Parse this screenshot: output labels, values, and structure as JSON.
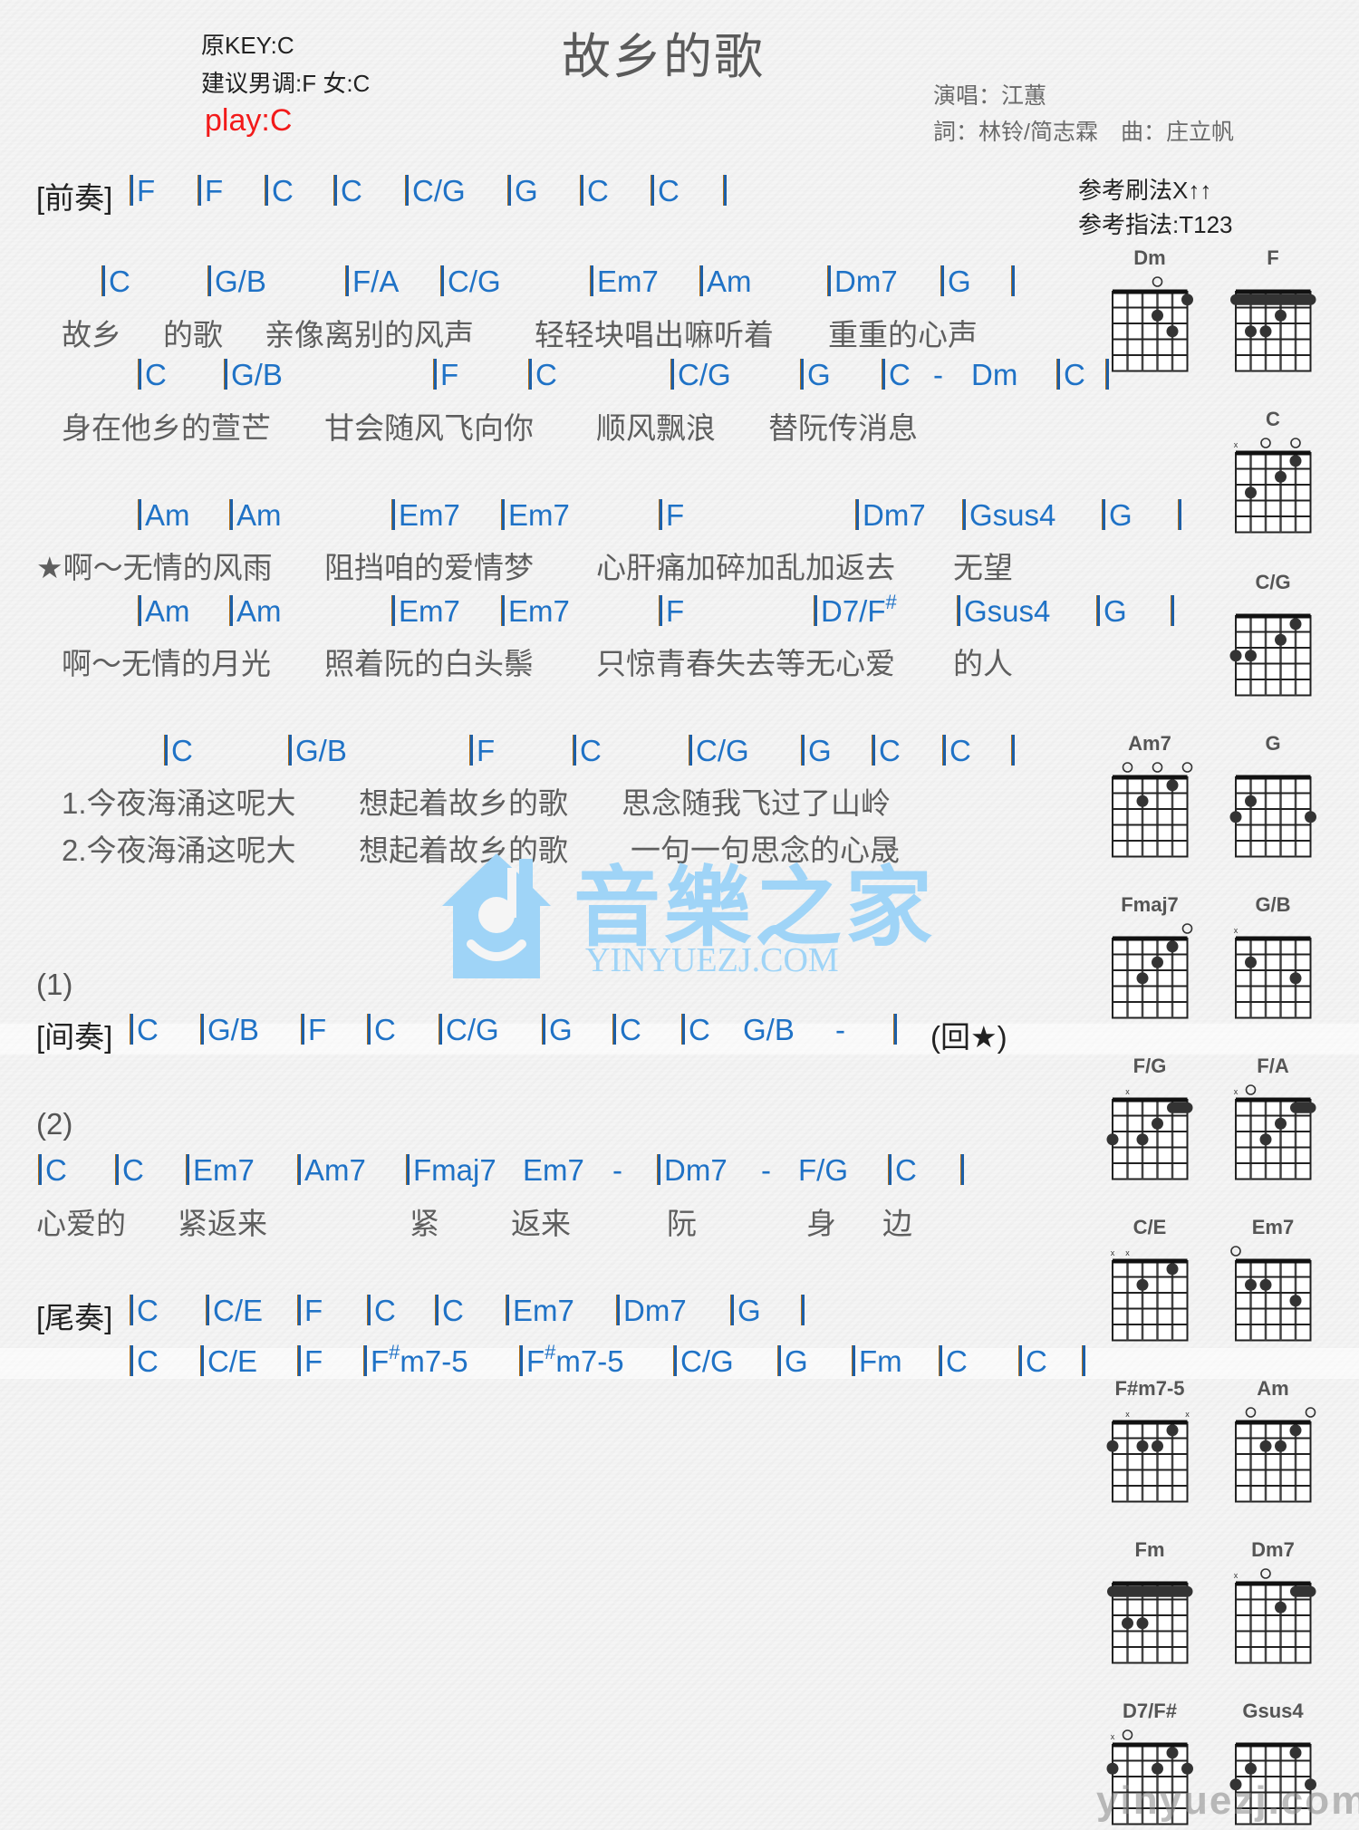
{
  "header": {
    "title": "故乡的歌",
    "original_key": "原KEY:C",
    "suggested_key": "建议男调:F 女:C",
    "play_key": "play:C",
    "singer": "演唱：江蕙",
    "credits": "詞：林铃/简志霖　曲：庄立帆",
    "strum_pattern": "参考刷法X↑↑",
    "finger_pattern": "参考指法:T123"
  },
  "colors": {
    "chord": "#1f72c6",
    "play_key": "#f21a1a",
    "lyric": "#5e5e5e",
    "watermark": "#9fd4f7"
  },
  "sheet": {
    "prelude": {
      "section": "[前奏]",
      "chords": [
        "F",
        "F",
        "C",
        "C",
        "C/G",
        "G",
        "C",
        "C",
        ""
      ]
    },
    "verse_1": {
      "chords": [
        "C",
        "G/B",
        "F/A",
        "C/G",
        "Em7",
        "Am",
        "Dm7",
        "G",
        ""
      ],
      "lyrics": [
        "故乡",
        "的歌",
        "亲像离别的风声",
        "轻轻块唱出嘛听着",
        "重重的心声"
      ]
    },
    "verse_2": {
      "chords": [
        "C",
        "G/B",
        "F",
        "C",
        "C/G",
        "G",
        "C",
        "-",
        "Dm",
        "C",
        ""
      ],
      "lyrics": [
        "身在他乡的萱芒",
        "甘会随风飞向你",
        "顺风飘浪",
        "替阮传消息"
      ]
    },
    "chorus_1": {
      "chords": [
        "Am",
        "Am",
        "Em7",
        "Em7",
        "F",
        "Dm7",
        "Gsus4",
        "G",
        ""
      ],
      "lyrics": [
        "★啊～无情的风雨",
        "阻挡咱的爱情梦",
        "心肝痛加碎加乱加返去",
        "无望"
      ]
    },
    "chorus_2": {
      "chords": [
        "Am",
        "Am",
        "Em7",
        "Em7",
        "F",
        "D7/F#",
        "Gsus4",
        "G",
        ""
      ],
      "lyrics": [
        "啊～无情的月光",
        "照着阮的白头鬃",
        "只惊青春失去等无心爱",
        "的人"
      ]
    },
    "bridge": {
      "chords": [
        "C",
        "G/B",
        "F",
        "C",
        "C/G",
        "G",
        "C",
        "C",
        ""
      ],
      "lyrics_1": [
        "1.今夜海涌这呢大",
        "想起着故乡的歌",
        "思念随我飞过了山岭"
      ],
      "lyrics_2": [
        "2.今夜海涌这呢大",
        "想起着故乡的歌",
        "一句一句思念的心晟"
      ]
    },
    "ending_1_label": "(1)",
    "interlude": {
      "section": "[间奏]",
      "chords": [
        "C",
        "G/B",
        "F",
        "C",
        "C/G",
        "G",
        "C",
        "C",
        "G/B",
        "-",
        ""
      ],
      "return_mark": "(回★)"
    },
    "ending_2_label": "(2)",
    "coda": {
      "chords": [
        "C",
        "C",
        "Em7",
        "Am7",
        "Fmaj7",
        "Em7",
        "-",
        "Dm7",
        "-",
        "F/G",
        "C",
        ""
      ],
      "lyrics": [
        "心爱的",
        "紧返来",
        "紧",
        "返来",
        "阮",
        "身",
        "边"
      ]
    },
    "outro": {
      "section": "[尾奏]",
      "chords_1": [
        "C",
        "C/E",
        "F",
        "C",
        "C",
        "Em7",
        "Dm7",
        "G",
        ""
      ],
      "chords_2": [
        "C",
        "C/E",
        "F",
        "F#m7-5",
        "F#m7-5",
        "C/G",
        "G",
        "Fm",
        "C",
        "C",
        ""
      ]
    }
  },
  "chord_charts": [
    {
      "name": "Dm",
      "open": [
        4
      ],
      "muted": [],
      "dots": [
        [
          6,
          1
        ],
        [
          4,
          2
        ],
        [
          5,
          3
        ]
      ],
      "barre": null
    },
    {
      "name": "F",
      "open": [],
      "muted": [],
      "dots": [
        [
          4,
          2
        ],
        [
          2,
          3
        ],
        [
          3,
          3
        ]
      ],
      "barre": {
        "fret": 1,
        "from": 1,
        "to": 6
      }
    },
    {
      "name": "C",
      "open": [
        3,
        5
      ],
      "muted": [
        1
      ],
      "dots": [
        [
          5,
          1
        ],
        [
          4,
          2
        ],
        [
          2,
          3
        ]
      ],
      "barre": null
    },
    {
      "name": "C/G",
      "open": [],
      "muted": [],
      "dots": [
        [
          5,
          1
        ],
        [
          4,
          2
        ],
        [
          1,
          3
        ],
        [
          2,
          3
        ]
      ],
      "barre": null
    },
    {
      "name": "Am7",
      "open": [
        2,
        4,
        6
      ],
      "muted": [],
      "dots": [
        [
          5,
          1
        ],
        [
          3,
          2
        ]
      ],
      "barre": null
    },
    {
      "name": "G",
      "open": [],
      "muted": [],
      "dots": [
        [
          2,
          2
        ],
        [
          1,
          3
        ],
        [
          6,
          3
        ]
      ],
      "barre": null
    },
    {
      "name": "Fmaj7",
      "open": [
        6
      ],
      "muted": [],
      "dots": [
        [
          5,
          1
        ],
        [
          4,
          2
        ],
        [
          3,
          3
        ]
      ],
      "barre": null
    },
    {
      "name": "G/B",
      "open": [],
      "muted": [
        1
      ],
      "dots": [
        [
          2,
          2
        ],
        [
          5,
          3
        ]
      ],
      "barre": null
    },
    {
      "name": "F/G",
      "open": [],
      "muted": [
        2
      ],
      "dots": [
        [
          4,
          2
        ],
        [
          1,
          3
        ],
        [
          3,
          3
        ]
      ],
      "barre": {
        "fret": 1,
        "from": 5,
        "to": 6
      }
    },
    {
      "name": "F/A",
      "open": [
        2
      ],
      "muted": [
        1
      ],
      "dots": [
        [
          4,
          2
        ],
        [
          3,
          3
        ]
      ],
      "barre": {
        "fret": 1,
        "from": 5,
        "to": 6
      }
    },
    {
      "name": "C/E",
      "open": [],
      "muted": [
        1,
        2
      ],
      "dots": [
        [
          5,
          1
        ],
        [
          3,
          2
        ]
      ],
      "barre": null
    },
    {
      "name": "Em7",
      "open": [
        1
      ],
      "muted": [],
      "dots": [
        [
          2,
          2
        ],
        [
          3,
          2
        ],
        [
          5,
          3
        ]
      ],
      "barre": null
    },
    {
      "name": "F#m7-5",
      "open": [],
      "muted": [
        2,
        6
      ],
      "dots": [
        [
          5,
          1
        ],
        [
          1,
          2
        ],
        [
          3,
          2
        ],
        [
          4,
          2
        ]
      ],
      "barre": null
    },
    {
      "name": "Am",
      "open": [
        2,
        6
      ],
      "muted": [],
      "dots": [
        [
          5,
          1
        ],
        [
          3,
          2
        ],
        [
          4,
          2
        ]
      ],
      "barre": null
    },
    {
      "name": "Fm",
      "open": [],
      "muted": [],
      "dots": [
        [
          2,
          3
        ],
        [
          3,
          3
        ]
      ],
      "barre": {
        "fret": 1,
        "from": 1,
        "to": 6
      }
    },
    {
      "name": "Dm7",
      "open": [
        3
      ],
      "muted": [
        1
      ],
      "dots": [
        [
          4,
          2
        ]
      ],
      "barre": {
        "fret": 1,
        "from": 5,
        "to": 6
      }
    },
    {
      "name": "D7/F#",
      "open": [
        2
      ],
      "muted": [
        1
      ],
      "dots": [
        [
          5,
          1
        ],
        [
          1,
          2
        ],
        [
          4,
          2
        ],
        [
          6,
          2
        ]
      ],
      "barre": null
    },
    {
      "name": "Gsus4",
      "open": [],
      "muted": [],
      "dots": [
        [
          5,
          1
        ],
        [
          2,
          2
        ],
        [
          1,
          3
        ],
        [
          6,
          3
        ]
      ],
      "barre": null
    }
  ],
  "watermark": {
    "brand_cn": "音樂之家",
    "brand_en": "YINYUEZJ.COM",
    "corner_text": "yinyuezj.com"
  }
}
